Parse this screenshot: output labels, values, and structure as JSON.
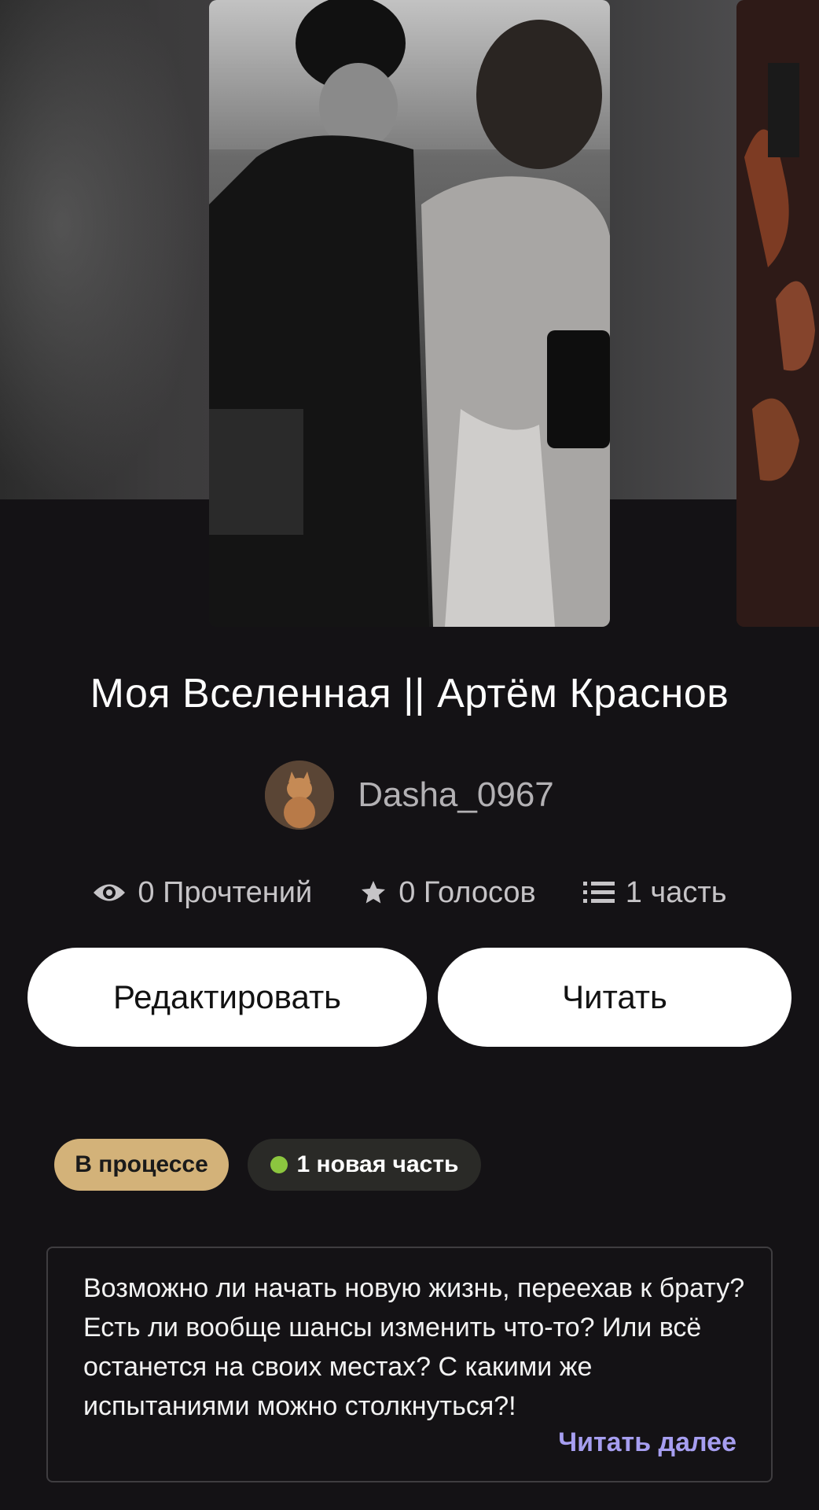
{
  "story": {
    "title": "Моя Вселенная || Артём Краснов",
    "author": "Dasha_0967"
  },
  "stats": {
    "reads": "0 Прочтений",
    "votes": "0 Голосов",
    "parts": "1 часть"
  },
  "buttons": {
    "edit": "Редактировать",
    "read": "Читать"
  },
  "badges": {
    "status": "В процессе",
    "new_parts": "1 новая часть"
  },
  "description": {
    "text": "Возможно ли начать новую жизнь, переехав к брату? Есть ли вообще шансы изменить что-то? Или всё останется на своих местах? С какими же испытаниями можно столкнуться?!",
    "read_more": "Читать далее"
  },
  "colors": {
    "background": "#141215",
    "status_badge": "#d3b279",
    "new_dot": "#8cc63f",
    "read_more": "#a69ef0"
  }
}
